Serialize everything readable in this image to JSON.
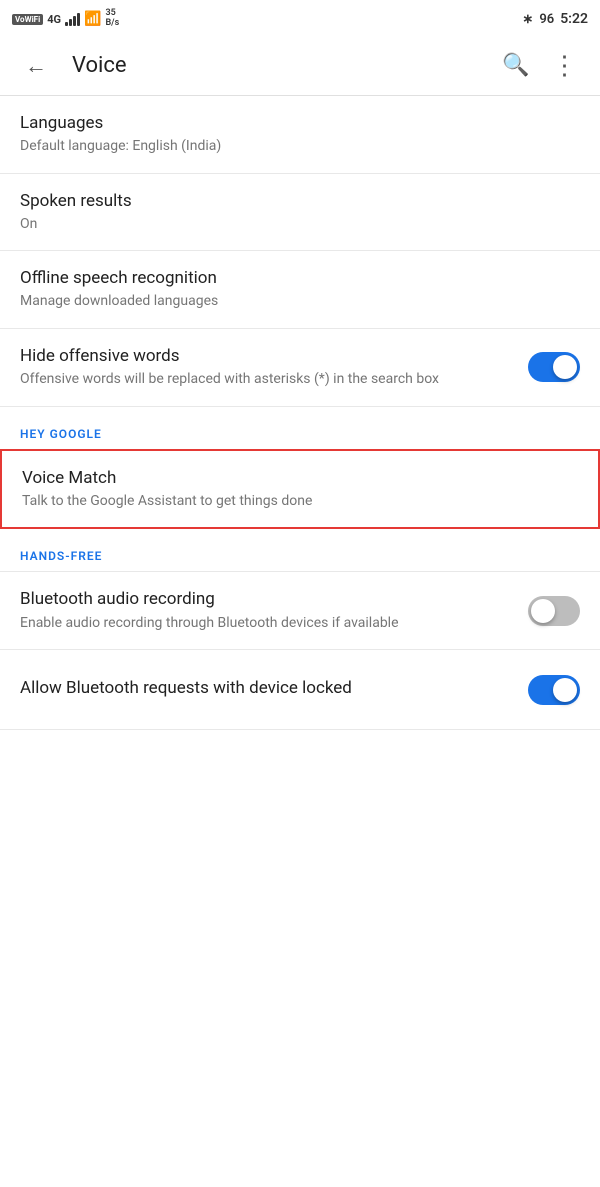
{
  "statusBar": {
    "left": {
      "vowifi": "VoWiFi",
      "network": "4G",
      "speed": "35\nB/s"
    },
    "right": {
      "time": "5:22",
      "battery": "96"
    }
  },
  "appBar": {
    "title": "Voice",
    "backLabel": "←",
    "searchLabel": "⌕",
    "moreLabel": "⋮"
  },
  "settings": {
    "sectionHeyGoogle": "HEY GOOGLE",
    "sectionHandsFree": "HANDS-FREE",
    "items": [
      {
        "id": "languages",
        "title": "Languages",
        "subtitle": "Default language: English (India)",
        "hasToggle": false,
        "toggleOn": false
      },
      {
        "id": "spoken-results",
        "title": "Spoken results",
        "subtitle": "On",
        "hasToggle": false,
        "toggleOn": false
      },
      {
        "id": "offline-speech",
        "title": "Offline speech recognition",
        "subtitle": "Manage downloaded languages",
        "hasToggle": false,
        "toggleOn": false
      },
      {
        "id": "hide-offensive",
        "title": "Hide offensive words",
        "subtitle": "Offensive words will be replaced with asterisks (*) in the search box",
        "hasToggle": true,
        "toggleOn": true
      }
    ],
    "voiceMatch": {
      "title": "Voice Match",
      "subtitle": "Talk to the Google Assistant to get things done"
    },
    "handsFreeItems": [
      {
        "id": "bluetooth-audio",
        "title": "Bluetooth audio recording",
        "subtitle": "Enable audio recording through Bluetooth devices if available",
        "hasToggle": true,
        "toggleOn": false
      },
      {
        "id": "bluetooth-locked",
        "title": "Allow Bluetooth requests with device locked",
        "subtitle": "",
        "hasToggle": true,
        "toggleOn": true
      }
    ]
  }
}
